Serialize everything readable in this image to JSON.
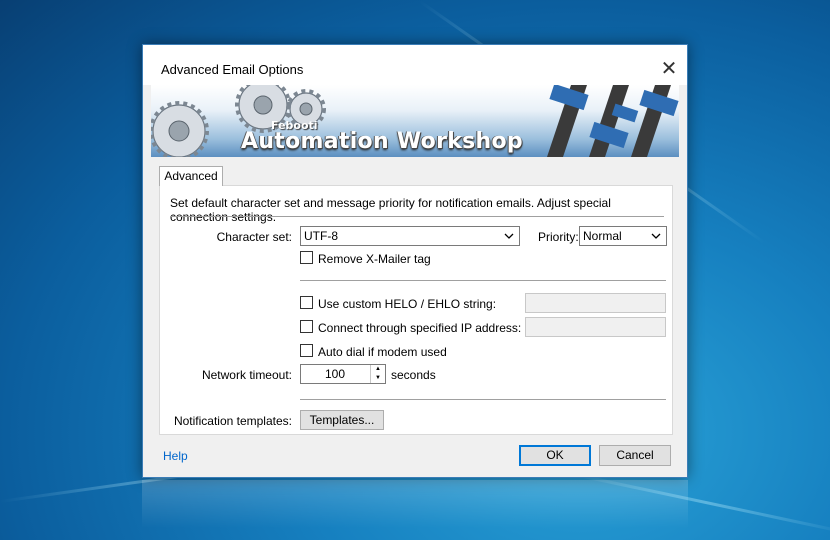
{
  "window": {
    "title": "Advanced Email Options",
    "close_glyph": "✕"
  },
  "banner": {
    "brand": "Febooti",
    "product": "Automation Workshop"
  },
  "tabs": [
    {
      "label": "Advanced"
    }
  ],
  "panel": {
    "description": "Set default character set and message priority for notification emails. Adjust special connection settings.",
    "charset": {
      "label": "Character set:",
      "value": "UTF-8"
    },
    "priority": {
      "label": "Priority:",
      "value": "Normal"
    },
    "remove_xmailer": {
      "label": "Remove X-Mailer tag",
      "checked": false
    },
    "custom_helo": {
      "label": "Use custom HELO / EHLO string:",
      "checked": false,
      "value": ""
    },
    "connect_ip": {
      "label": "Connect through specified IP address:",
      "checked": false,
      "value": ""
    },
    "auto_dial": {
      "label": "Auto dial if modem used",
      "checked": false
    },
    "timeout": {
      "label": "Network timeout:",
      "value": "100",
      "unit": "seconds"
    },
    "templates": {
      "label": "Notification templates:",
      "button": "Templates..."
    }
  },
  "footer": {
    "help": "Help",
    "ok": "OK",
    "cancel": "Cancel"
  },
  "icons": {
    "dropdown": "chevron-down-icon",
    "spin_up": "spin-up-icon",
    "spin_down": "spin-down-icon",
    "close": "close-icon"
  },
  "colors": {
    "accent": "#0078d7",
    "link": "#0066cc",
    "desktop": "#1680c0"
  }
}
